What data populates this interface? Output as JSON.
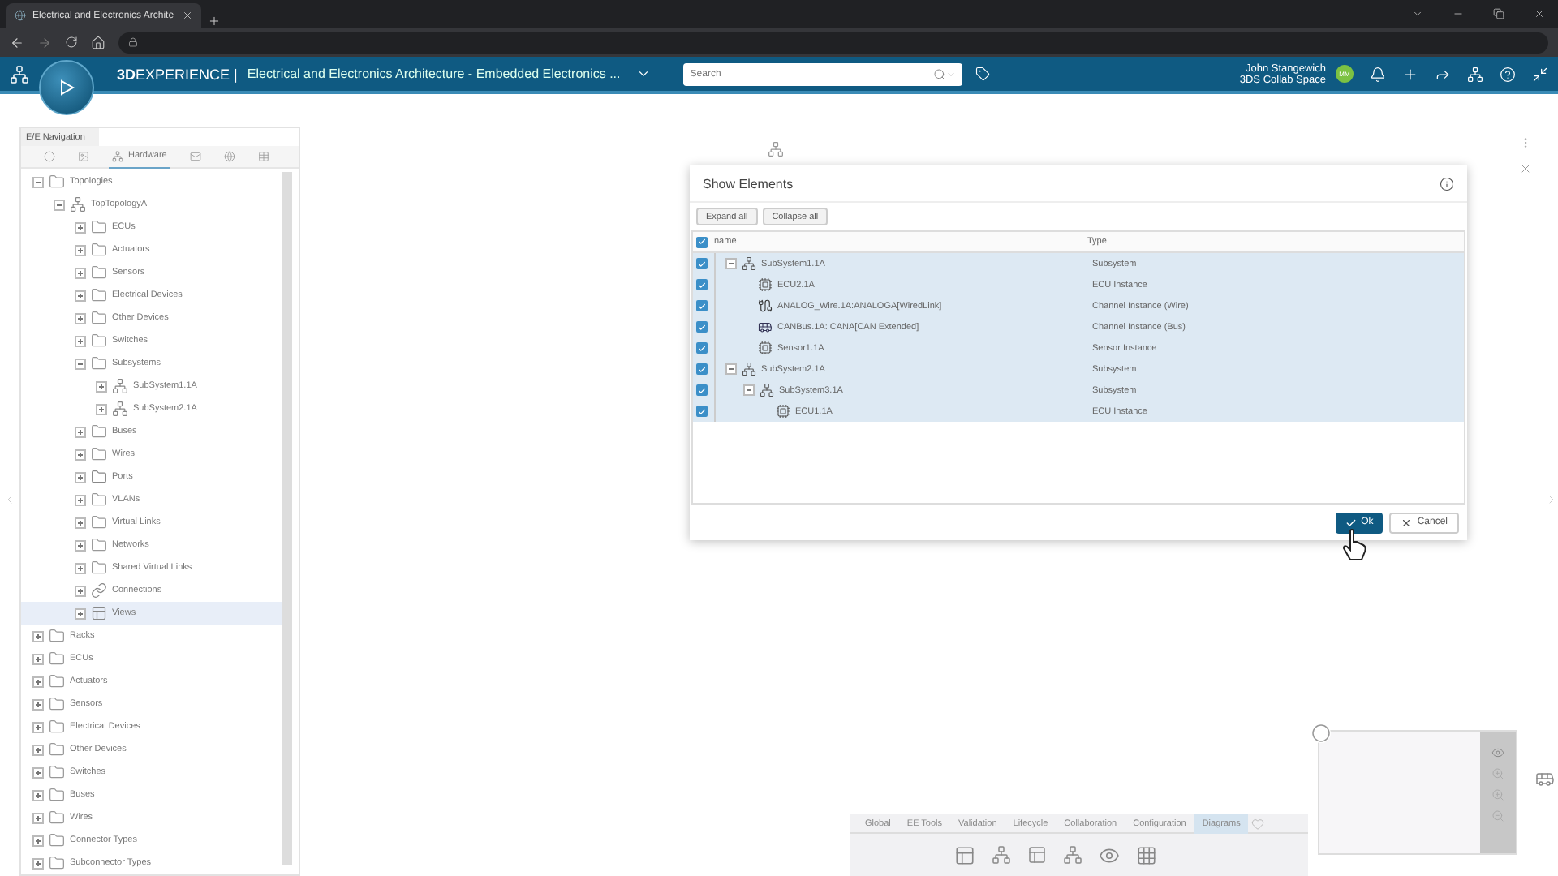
{
  "browser": {
    "tab_title": "Electrical and Electronics Archite"
  },
  "header": {
    "brand_bold": "3D",
    "brand_rest": "EXPERIENCE |",
    "app_title": "Electrical and Electronics Architecture - Embedded Electronics ...",
    "search": {
      "placeholder": "Search"
    },
    "user_name": "John Stangewich",
    "space": "3DS Collab Space",
    "avatar": "MM"
  },
  "navigation": {
    "title": "E/E Navigation",
    "tabs": [
      {
        "kind": "objects",
        "selected": false
      },
      {
        "kind": "image",
        "selected": false
      },
      {
        "kind": "hardware",
        "label": "Hardware",
        "selected": true
      },
      {
        "kind": "mail",
        "selected": false
      },
      {
        "kind": "globe",
        "selected": false
      },
      {
        "kind": "table",
        "selected": false
      }
    ],
    "tree": [
      {
        "label": "Topologies",
        "kind": "folder",
        "expanded": true,
        "selected": false,
        "children": [
          {
            "label": "TopTopologyA",
            "kind": "topology",
            "expanded": true,
            "selected": false,
            "children": [
              {
                "label": "ECUs",
                "kind": "folder",
                "expanded": false,
                "selected": false
              },
              {
                "label": "Actuators",
                "kind": "folder",
                "expanded": false,
                "selected": false
              },
              {
                "label": "Sensors",
                "kind": "folder",
                "expanded": false,
                "selected": false
              },
              {
                "label": "Electrical Devices",
                "kind": "folder",
                "expanded": false,
                "selected": false
              },
              {
                "label": "Other Devices",
                "kind": "folder",
                "expanded": false,
                "selected": false
              },
              {
                "label": "Switches",
                "kind": "folder",
                "expanded": false,
                "selected": false
              },
              {
                "label": "Subsystems",
                "kind": "folder",
                "expanded": true,
                "selected": false,
                "children": [
                  {
                    "label": "SubSystem1.1A",
                    "kind": "subsystem",
                    "expanded": false,
                    "selected": false
                  },
                  {
                    "label": "SubSystem2.1A",
                    "kind": "subsystem",
                    "expanded": false,
                    "selected": false
                  }
                ]
              },
              {
                "label": "Buses",
                "kind": "folder",
                "expanded": false,
                "selected": false
              },
              {
                "label": "Wires",
                "kind": "folder",
                "expanded": false,
                "selected": false
              },
              {
                "label": "Ports",
                "kind": "ports",
                "expanded": false,
                "selected": false
              },
              {
                "label": "VLANs",
                "kind": "folder",
                "expanded": false,
                "selected": false
              },
              {
                "label": "Virtual Links",
                "kind": "folder",
                "expanded": false,
                "selected": false
              },
              {
                "label": "Networks",
                "kind": "folder",
                "expanded": false,
                "selected": false
              },
              {
                "label": "Shared Virtual Links",
                "kind": "folder",
                "expanded": false,
                "selected": false
              },
              {
                "label": "Connections",
                "kind": "connections",
                "expanded": false,
                "selected": false
              },
              {
                "label": "Views",
                "kind": "views",
                "expanded": false,
                "selected": true
              }
            ]
          }
        ]
      },
      {
        "label": "Racks",
        "kind": "folder",
        "expanded": false,
        "selected": false
      },
      {
        "label": "ECUs",
        "kind": "folder",
        "expanded": false,
        "selected": false
      },
      {
        "label": "Actuators",
        "kind": "folder",
        "expanded": false,
        "selected": false
      },
      {
        "label": "Sensors",
        "kind": "folder",
        "expanded": false,
        "selected": false
      },
      {
        "label": "Electrical Devices",
        "kind": "folder",
        "expanded": false,
        "selected": false
      },
      {
        "label": "Other Devices",
        "kind": "folder",
        "expanded": false,
        "selected": false
      },
      {
        "label": "Switches",
        "kind": "folder",
        "expanded": false,
        "selected": false
      },
      {
        "label": "Buses",
        "kind": "folder",
        "expanded": false,
        "selected": false
      },
      {
        "label": "Wires",
        "kind": "folder",
        "expanded": false,
        "selected": false
      },
      {
        "label": "Connector Types",
        "kind": "folder",
        "expanded": false,
        "selected": false
      },
      {
        "label": "Subconnector Types",
        "kind": "folder",
        "expanded": false,
        "selected": false
      }
    ]
  },
  "dialog": {
    "title": "Show Elements",
    "buttons": [
      "Expand all",
      "Collapse all"
    ],
    "all_checked": true,
    "columns": [
      "name",
      "Type"
    ],
    "rows": [
      {
        "name": "SubSystem1.1A",
        "type": "Subsystem",
        "kind": "subsystem",
        "checked": true,
        "expanded": true,
        "children": [
          {
            "name": "ECU2.1A",
            "type": "ECU Instance",
            "kind": "ecu",
            "checked": true
          },
          {
            "name": "ANALOG_Wire.1A:ANALOGA[WiredLink]",
            "type": "Channel Instance (Wire)",
            "kind": "wire",
            "checked": true
          },
          {
            "name": "CANBus.1A: CANA[CAN Extended]",
            "type": "Channel Instance (Bus)",
            "kind": "bus",
            "checked": true
          },
          {
            "name": "Sensor1.1A",
            "type": "Sensor Instance",
            "kind": "ecu",
            "checked": true
          }
        ]
      },
      {
        "name": "SubSystem2.1A",
        "type": "Subsystem",
        "kind": "subsystem",
        "checked": true,
        "expanded": true,
        "children": [
          {
            "name": "SubSystem3.1A",
            "type": "Subsystem",
            "kind": "subsystem",
            "checked": true,
            "expanded": true,
            "children": [
              {
                "name": "ECU1.1A",
                "type": "ECU Instance",
                "kind": "ecu",
                "checked": true
              }
            ]
          }
        ]
      }
    ],
    "ok": "Ok",
    "cancel": "Cancel"
  },
  "toolbar": {
    "tabs": [
      {
        "label": "Global",
        "selected": false
      },
      {
        "label": "EE Tools",
        "selected": false
      },
      {
        "label": "Validation",
        "selected": false
      },
      {
        "label": "Lifecycle",
        "selected": false
      },
      {
        "label": "Collaboration",
        "selected": false
      },
      {
        "label": "Configuration",
        "selected": false
      },
      {
        "label": "Diagrams",
        "selected": true
      }
    ]
  }
}
